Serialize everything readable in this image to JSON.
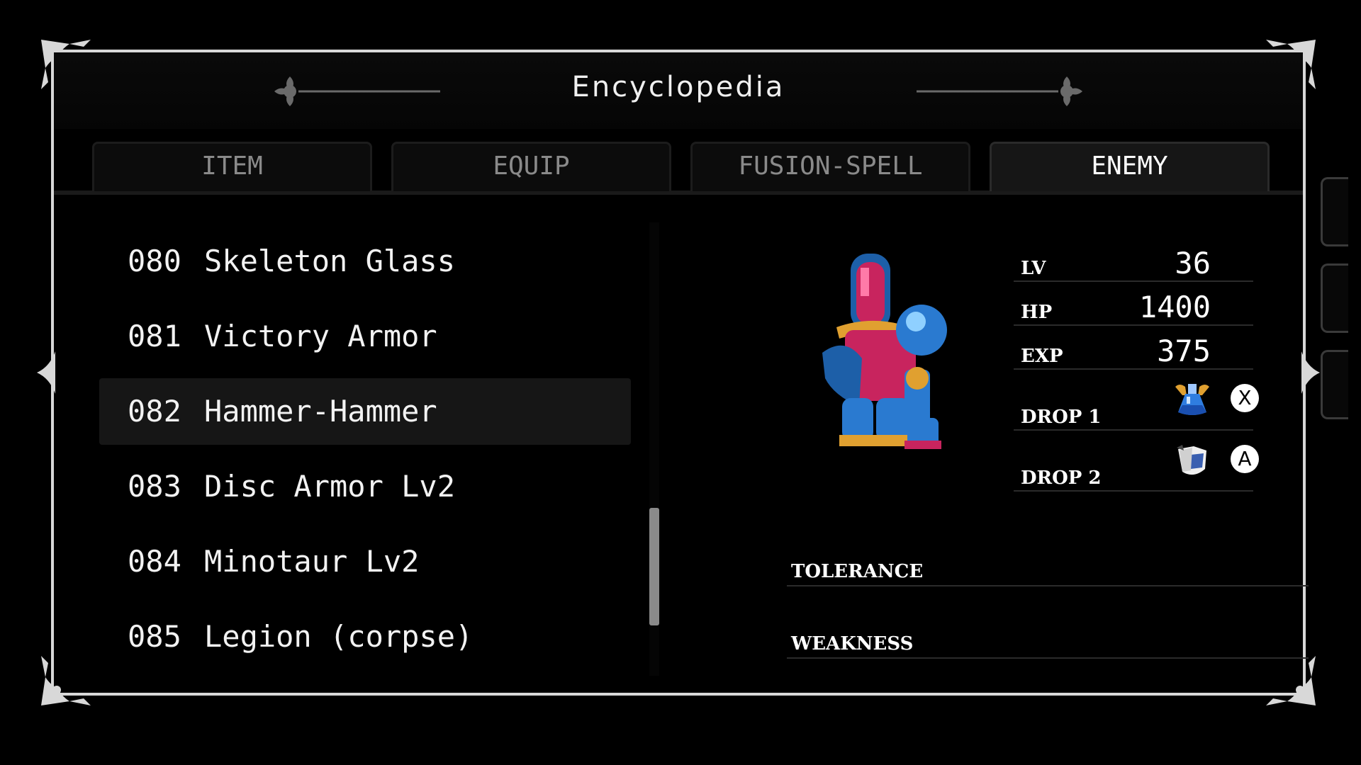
{
  "header": {
    "title": "Encyclopedia"
  },
  "tabs": [
    {
      "label": "ITEM",
      "active": false
    },
    {
      "label": "EQUIP",
      "active": false
    },
    {
      "label": "FUSION-SPELL",
      "active": false
    },
    {
      "label": "ENEMY",
      "active": true
    }
  ],
  "list": {
    "items": [
      {
        "num": "080",
        "name": "Skeleton Glass",
        "selected": false
      },
      {
        "num": "081",
        "name": "Victory Armor",
        "selected": false
      },
      {
        "num": "082",
        "name": "Hammer-Hammer",
        "selected": true
      },
      {
        "num": "083",
        "name": "Disc Armor Lv2",
        "selected": false
      },
      {
        "num": "084",
        "name": "Minotaur Lv2",
        "selected": false
      },
      {
        "num": "085",
        "name": "Legion (corpse)",
        "selected": false
      }
    ],
    "scroll_position": 0.85
  },
  "enemy": {
    "sprite_icon": "armored-knight-sprite",
    "stats": {
      "lv_label": "LV",
      "lv": "36",
      "hp_label": "HP",
      "hp": "1400",
      "exp_label": "EXP",
      "exp": "375"
    },
    "drops": [
      {
        "label": "DROP 1",
        "icon": "potion-icon",
        "button": "X"
      },
      {
        "label": "DROP 2",
        "icon": "shield-armor-icon",
        "button": "A"
      }
    ],
    "tolerance_label": "TOLERANCE",
    "weakness_label": "WEAKNESS"
  },
  "colors": {
    "frame": "#d8d8d8",
    "selected_row": "#161616",
    "inactive_tab_text": "#8a8a8a"
  }
}
